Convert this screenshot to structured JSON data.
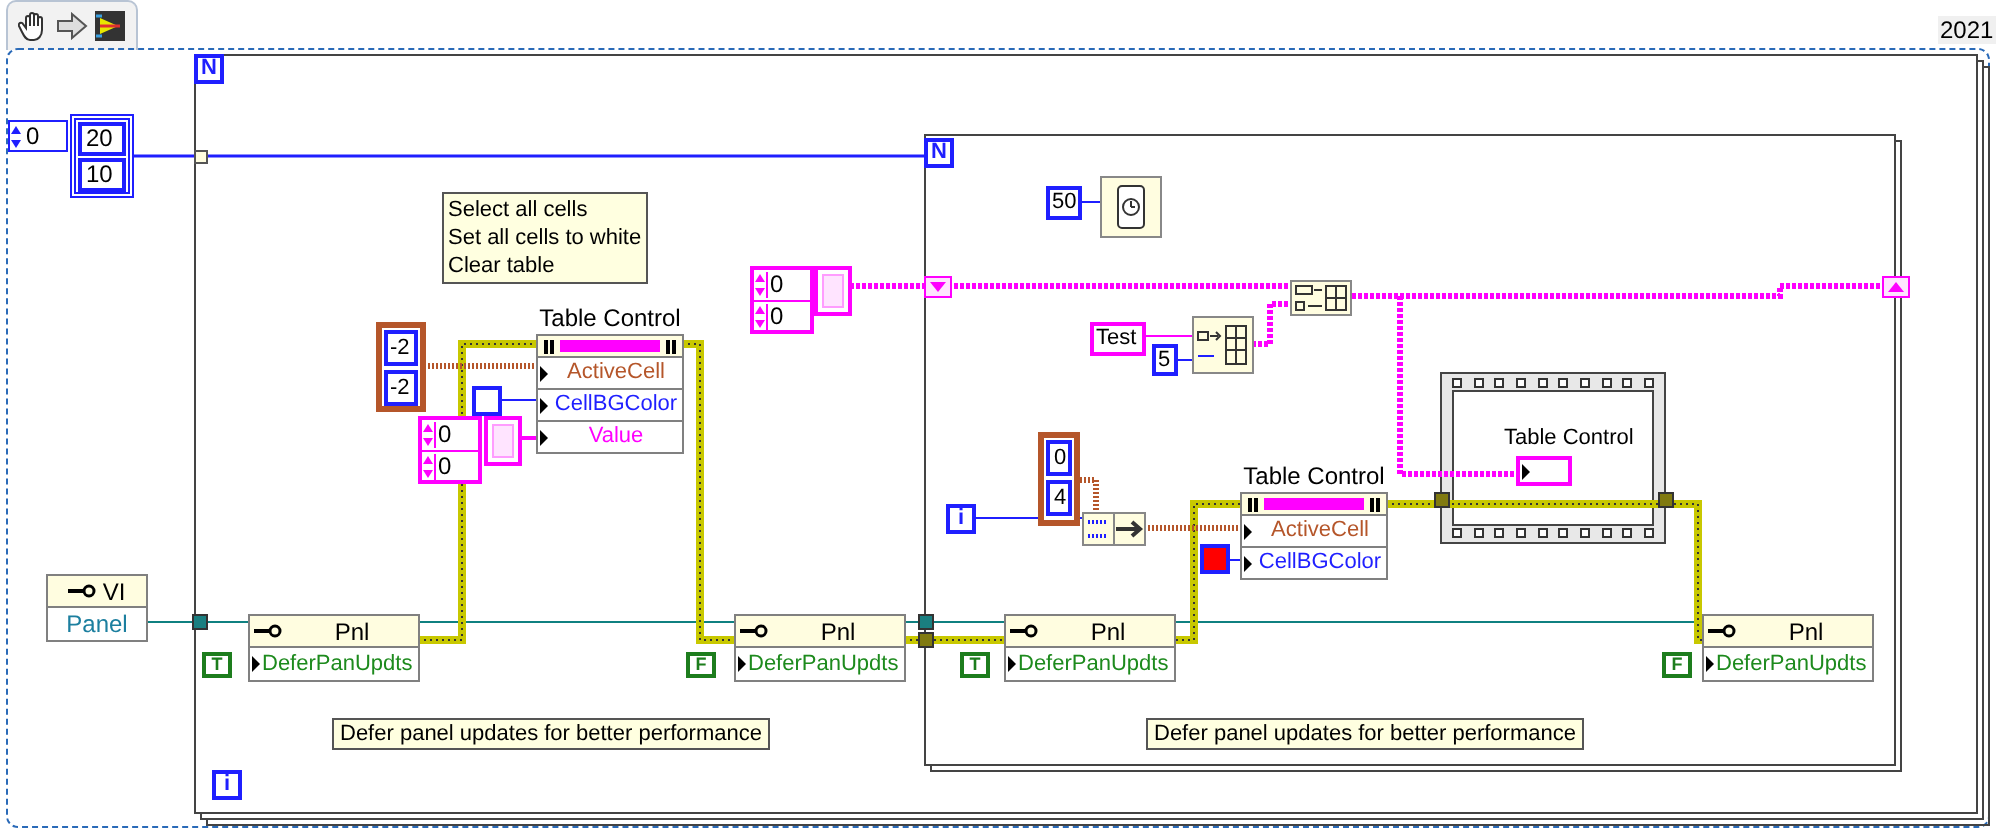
{
  "version_label": "2021",
  "outer_loop": {
    "count": "N",
    "index": "i"
  },
  "size_array": {
    "index": "0",
    "values": [
      "20",
      "10"
    ]
  },
  "vi_reference": {
    "title": "VI",
    "property": "Panel"
  },
  "comments": [
    "Select all cells\nSet all cells to white\nClear table",
    "Defer panel updates for better performance",
    "Defer panel updates for better performance"
  ],
  "select_cluster": {
    "values": [
      "-2",
      "-2"
    ]
  },
  "index_clusters": [
    {
      "values": [
        "0",
        "0"
      ]
    },
    {
      "values": [
        "0",
        "0"
      ]
    }
  ],
  "color_constants": [
    {
      "color": "#ffffff"
    },
    {
      "color": "#ff0000"
    }
  ],
  "table_property_nodes": [
    {
      "label": "Table Control",
      "properties": [
        {
          "name": "ActiveCell",
          "kind": "cluster"
        },
        {
          "name": "CellBGColor",
          "kind": "color"
        },
        {
          "name": "Value",
          "kind": "string"
        }
      ]
    },
    {
      "label": "Table Control",
      "properties": [
        {
          "name": "ActiveCell",
          "kind": "cluster"
        },
        {
          "name": "CellBGColor",
          "kind": "color"
        }
      ]
    }
  ],
  "defer_nodes": [
    {
      "title": "Pnl",
      "property": "DeferPanUpdts",
      "value": "T"
    },
    {
      "title": "Pnl",
      "property": "DeferPanUpdts",
      "value": "F"
    },
    {
      "title": "Pnl",
      "property": "DeferPanUpdts",
      "value": "T"
    },
    {
      "title": "Pnl",
      "property": "DeferPanUpdts",
      "value": "F"
    }
  ],
  "inner_loop": {
    "count": "N",
    "wait_ms": "50",
    "init_value": "Test",
    "init_size": "5",
    "cell_cluster": {
      "values": [
        "0",
        "4"
      ]
    },
    "loop_index": "i",
    "terminal_label": "Table Control"
  }
}
